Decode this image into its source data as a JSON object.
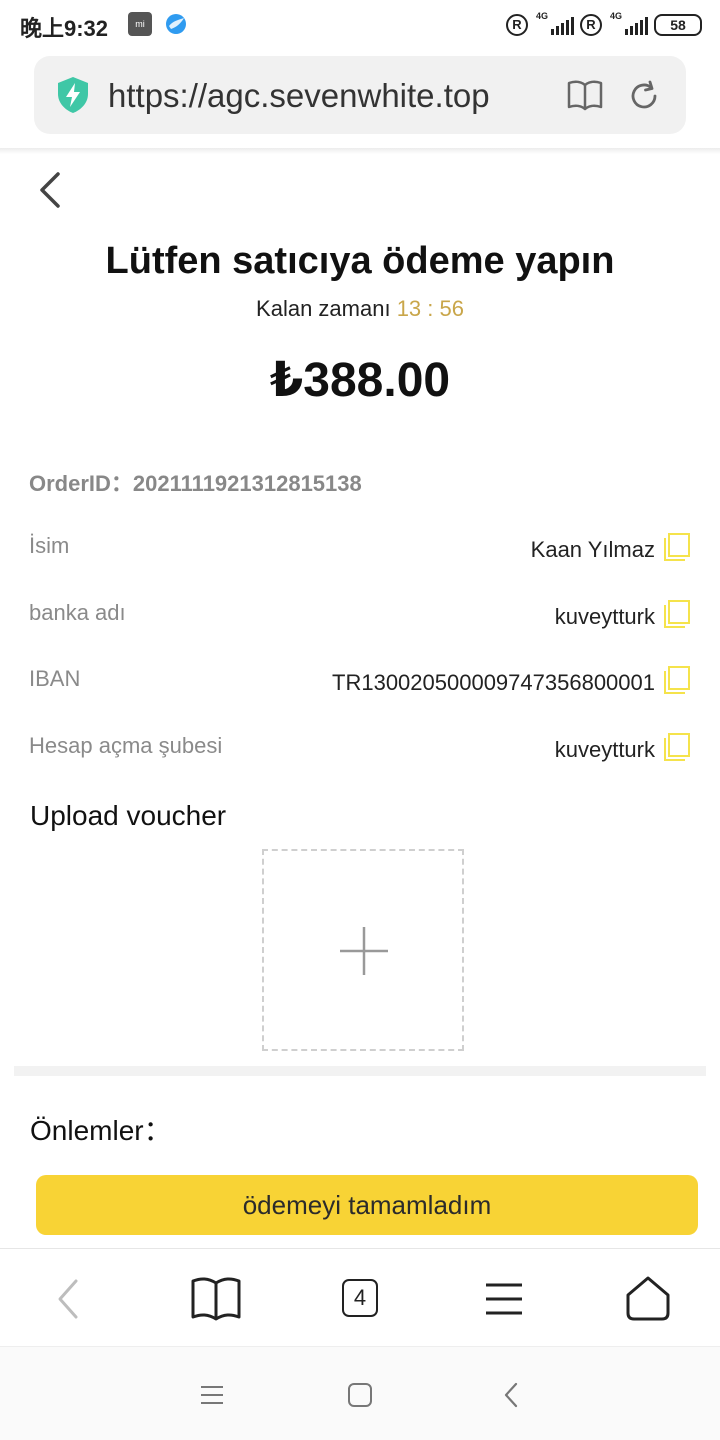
{
  "status_bar": {
    "time": "晚上9:32",
    "mi_label": "mi",
    "network_1": "4G",
    "network_2": "4G",
    "battery": "58"
  },
  "browser": {
    "url": "https://agc.sevenwhite.top",
    "tab_count": "4"
  },
  "page": {
    "title": "Lütfen satıcıya ödeme yapın",
    "timer_label": "Kalan zamanı",
    "timer_value": "13 : 56",
    "amount": "₺388.00",
    "order_label": "OrderID：",
    "order_id": "2021111921312815138",
    "fields": [
      {
        "label": "İsim",
        "value": "Kaan Yılmaz"
      },
      {
        "label": "banka adı",
        "value": "kuveytturk"
      },
      {
        "label": "IBAN",
        "value": "TR130020500009747356800001"
      },
      {
        "label": "Hesap açma şubesi",
        "value": "kuveytturk"
      }
    ],
    "upload_label": "Upload voucher",
    "notes_title": "Önlemler：",
    "confirm_button": "ödemeyi tamamladım"
  },
  "colors": {
    "accent_yellow": "#f8d335",
    "timer_color": "#c9a64a",
    "shield_green": "#3fc7a6"
  }
}
